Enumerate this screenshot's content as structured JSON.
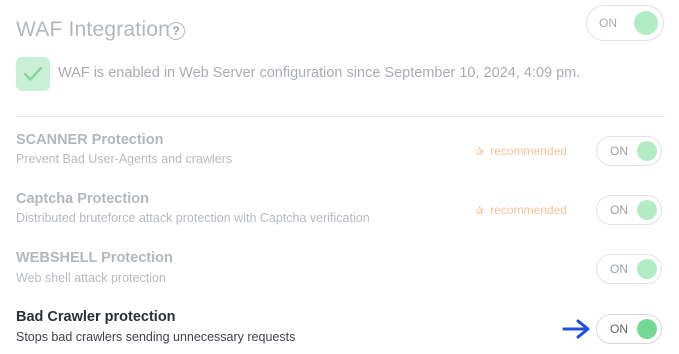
{
  "header": {
    "title": "WAF Integration",
    "help_icon": "question-circle-icon",
    "toggle_label": "ON"
  },
  "info": {
    "icon": "checkmark-icon",
    "text": "WAF is enabled in Web Server configuration since September 10, 2024, 4:09 pm."
  },
  "sections": [
    {
      "title": "SCANNER Protection",
      "desc": "Prevent Bad User-Agents and crawlers",
      "recommended": "recommended",
      "toggle_label": "ON"
    },
    {
      "title": "Captcha Protection",
      "desc": "Distributed bruteforce attack protection with Captcha verification",
      "recommended": "recommended",
      "toggle_label": "ON"
    },
    {
      "title": "WEBSHELL Protection",
      "desc": "Web shell attack protection",
      "toggle_label": "ON"
    },
    {
      "title": "Bad Crawler protection",
      "desc": "Stops bad crawlers sending unnecessary requests",
      "toggle_label": "ON"
    }
  ],
  "indicator": {
    "icon": "arrow-right-icon",
    "color": "#1f4fe0"
  },
  "colors": {
    "toggle_on": "#74d993",
    "toggle_on_dim": "#b2ecc4",
    "recommended": "#f4c29b"
  }
}
